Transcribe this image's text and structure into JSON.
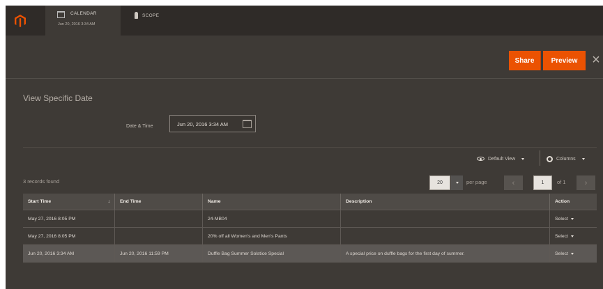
{
  "colors": {
    "accent": "#eb5202",
    "panel": "#3e3a36",
    "topbar": "#2f2b28"
  },
  "topbar": {
    "logo": "magento-logo-icon",
    "tabs": [
      {
        "label": "CALENDAR",
        "sub": "Jun 20, 2016 3:34 AM",
        "icon": "calendar-icon"
      },
      {
        "label": "SCOPE",
        "icon": "pin-icon"
      }
    ]
  },
  "actions": {
    "share": "Share",
    "preview": "Preview",
    "close": "×"
  },
  "section": {
    "title": "View Specific Date",
    "datetime_label": "Date & Time",
    "datetime_value": "Jun 20, 2016 3:34 AM"
  },
  "toolbar": {
    "default_view": "Default View",
    "columns": "Columns"
  },
  "grid": {
    "records": "3 records found",
    "per_page_value": "20",
    "per_page_label": "per page",
    "page": "1",
    "of": "of 1",
    "columns": [
      "Start Time",
      "End Time",
      "Name",
      "Description",
      "Action"
    ],
    "sort_indicator": "↓",
    "rows": [
      {
        "start": "May 27, 2016 8:05 PM",
        "end": "",
        "name": "24-MB04",
        "description": "",
        "action": "Select"
      },
      {
        "start": "May 27, 2016 8:05 PM",
        "end": "",
        "name": "20% off all Women's and Men's Pants",
        "description": "",
        "action": "Select"
      },
      {
        "start": "Jun 20, 2016 3:34 AM",
        "end": "Jun 20, 2016 11:59 PM",
        "name": "Duffle Bag Summer Solstice Special",
        "description": "A special price on duffle bags for the first day of summer.",
        "action": "Select"
      }
    ]
  }
}
